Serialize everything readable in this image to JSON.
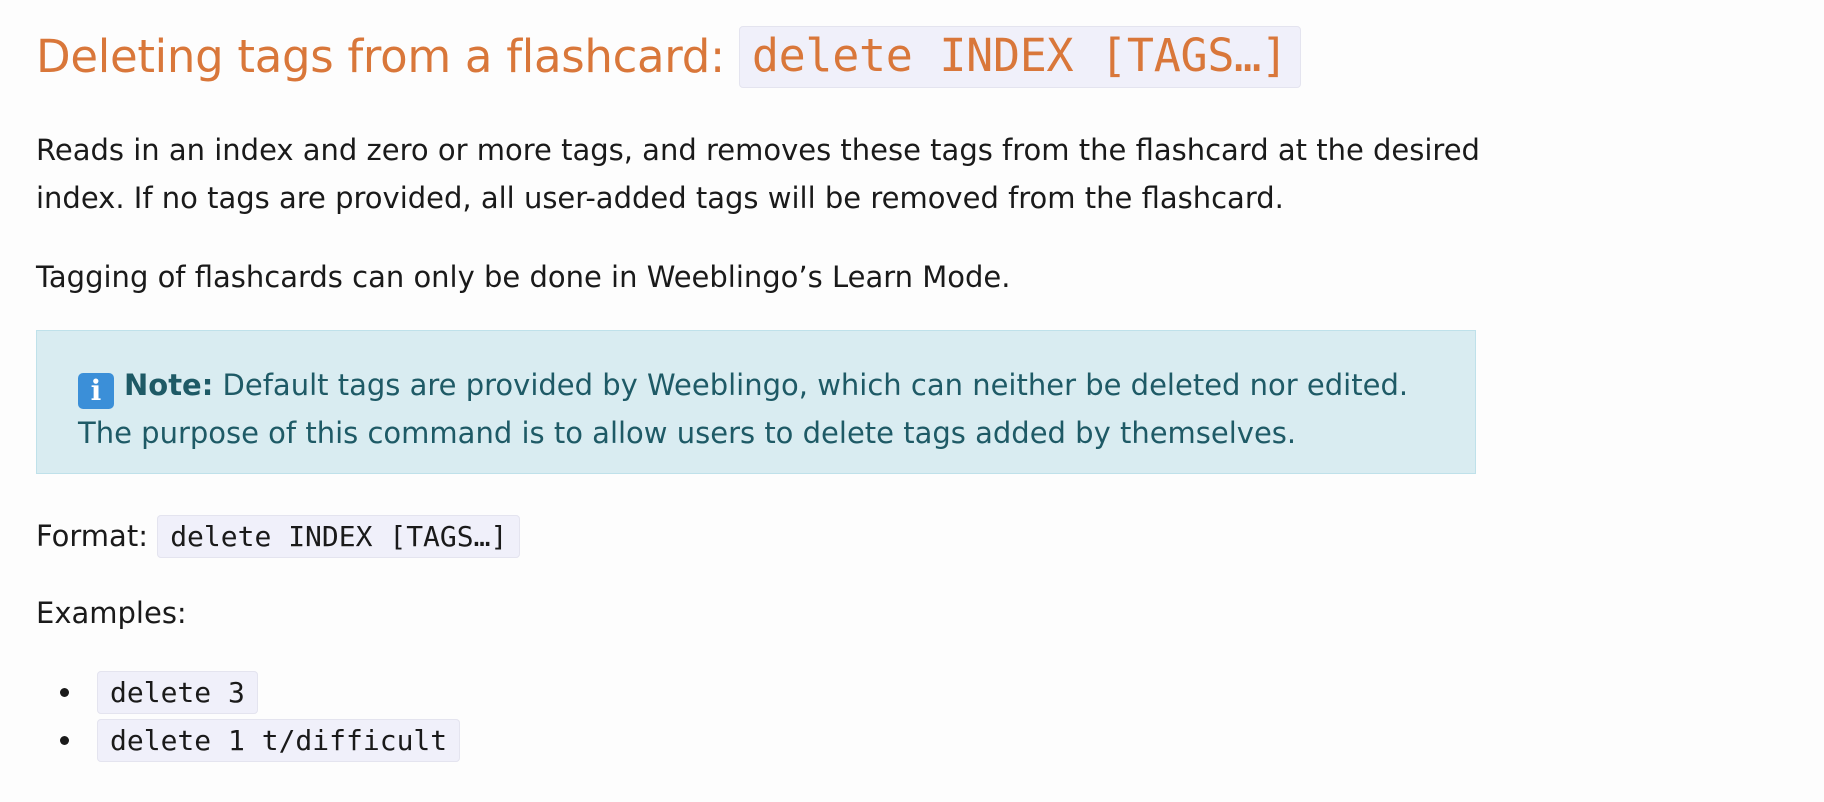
{
  "heading": {
    "text": "Deleting tags from a flashcard:",
    "code": "delete INDEX [TAGS…]"
  },
  "paragraphs": [
    "Reads in an index and zero or more tags, and removes these tags from the flashcard at the desired index. If no tags are provided, all user-added tags will be removed from the flashcard.",
    "Tagging of flashcards can only be done in Weeblingo’s Learn Mode."
  ],
  "note": {
    "icon": "info-icon",
    "icon_glyph": "i",
    "label": "Note:",
    "text": " Default tags are provided by Weeblingo, which can neither be deleted nor edited. The purpose of this command is to allow users to delete tags added by themselves."
  },
  "format": {
    "label": "Format: ",
    "code": "delete INDEX [TAGS…]"
  },
  "examples": {
    "label": "Examples:",
    "items": [
      "delete 3",
      "delete 1 t/difficult"
    ]
  },
  "colors": {
    "heading": "#d9773a",
    "note_background": "#d9ecf1",
    "note_text": "#1e5a66",
    "code_background": "#f0f0fa"
  }
}
